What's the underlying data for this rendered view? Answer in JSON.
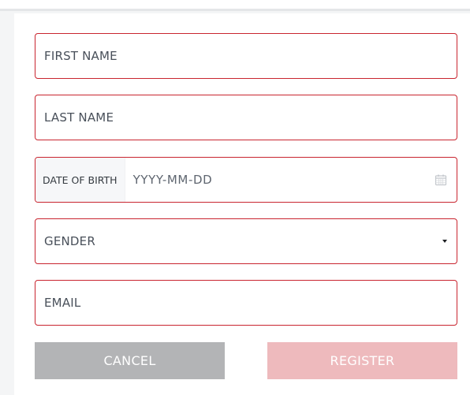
{
  "form": {
    "first_name": {
      "placeholder": "FIRST NAME"
    },
    "last_name": {
      "placeholder": "LAST NAME"
    },
    "date_of_birth": {
      "prefix_label": "DATE OF BIRTH",
      "placeholder": "YYYY-MM-DD",
      "icon": "calendar-icon"
    },
    "gender": {
      "selected": "GENDER",
      "icon": "caret-down-icon"
    },
    "email": {
      "placeholder": "EMAIL"
    }
  },
  "buttons": {
    "cancel_label": "CANCEL",
    "register_label": "REGISTER"
  },
  "colors": {
    "field_border": "#c9252f",
    "cancel_bg": "#b3b4b6",
    "register_bg_disabled": "#eebabd"
  }
}
